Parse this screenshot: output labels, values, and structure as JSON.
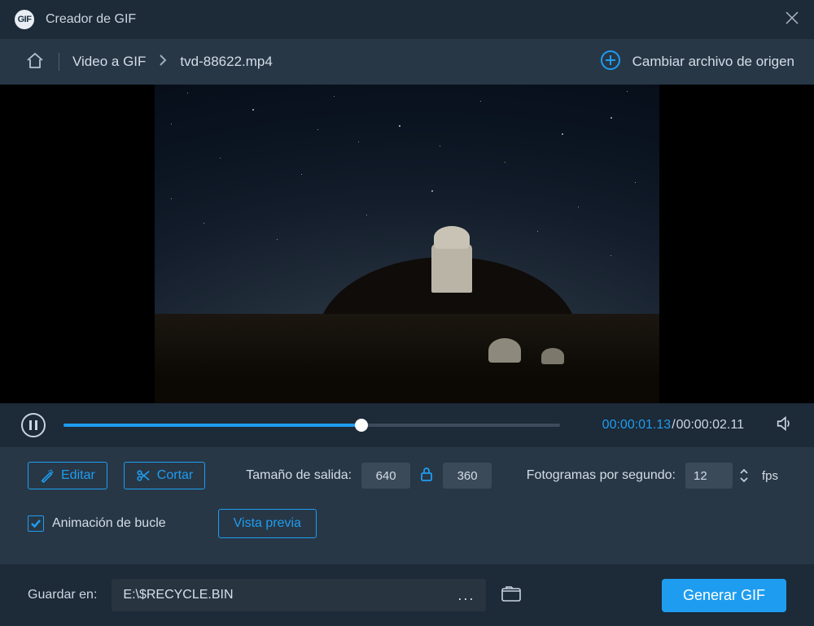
{
  "titlebar": {
    "app_icon_text": "GIF",
    "title": "Creador de GIF"
  },
  "crumbs": {
    "section": "Video a GIF",
    "file": "tvd-88622.mp4",
    "change_source": "Cambiar archivo de origen"
  },
  "playback": {
    "current": "00:00:01.13",
    "duration": "00:00:02.11"
  },
  "options": {
    "edit_label": "Editar",
    "cut_label": "Cortar",
    "size_label": "Tamaño de salida:",
    "width": "640",
    "height": "360",
    "fps_label": "Fotogramas por segundo:",
    "fps_value": "12",
    "fps_unit": "fps",
    "loop_label": "Animación de bucle",
    "preview_label": "Vista previa"
  },
  "footer": {
    "save_label": "Guardar en:",
    "path": "E:\\$RECYCLE.BIN",
    "more": "...",
    "generate_label": "Generar GIF"
  }
}
